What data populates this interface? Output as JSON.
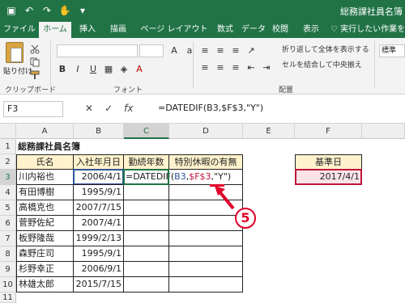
{
  "window": {
    "doc_title": "総務課社員名簿"
  },
  "ribbon": {
    "tabs": [
      "ファイル",
      "ホーム",
      "挿入",
      "描画",
      "ページ レイアウト",
      "数式",
      "データ",
      "校閲",
      "表示"
    ],
    "active_tab": "ホーム",
    "tell_me": "実行したい作業を入",
    "paste_label": "貼り付け",
    "group_clipboard": "クリップボード",
    "group_font": "フォント",
    "group_alignment": "配置",
    "wrap_text": "折り返して全体を表示する",
    "merge_center": "セルを結合して中央揃え",
    "number_format": "標準"
  },
  "formula_bar": {
    "name_box": "F3",
    "formula": "=DATEDIF(B3,$F$3,\"Y\")"
  },
  "sheet": {
    "columns": [
      "A",
      "B",
      "C",
      "D",
      "E",
      "F"
    ],
    "rows": [
      "1",
      "2",
      "3",
      "4",
      "5",
      "6",
      "7",
      "8",
      "9",
      "10",
      "11"
    ],
    "title": "総務課社員名簿",
    "headers": {
      "name": "氏名",
      "join_date": "入社年月日",
      "years": "勤続年数",
      "special_leave": "特別休暇の有無"
    },
    "employees": [
      {
        "name": "川内裕也",
        "date": "2006/4/1"
      },
      {
        "name": "有田博樹",
        "date": "1995/9/1"
      },
      {
        "name": "高橋克也",
        "date": "2007/7/15"
      },
      {
        "name": "菅野佐紀",
        "date": "2007/4/1"
      },
      {
        "name": "板野隆哉",
        "date": "1999/2/13"
      },
      {
        "name": "森野庄司",
        "date": "1995/9/1"
      },
      {
        "name": "杉野幸正",
        "date": "2006/9/1"
      },
      {
        "name": "林雄太郎",
        "date": "2015/7/15"
      }
    ],
    "editing": {
      "prefix": "=DATEDIF(",
      "ref_b3": "B3",
      "comma1": ",",
      "ref_f3": "$F$3",
      "tail": ",\"Y\")"
    },
    "base_date_label": "基準日",
    "base_date_value": "2017/4/1"
  },
  "annotation": {
    "step_number": "5"
  },
  "colors": {
    "excel_green": "#217346",
    "header_yellow": "#fff2cc",
    "base_pink": "#fbe4e8",
    "ref_blue": "#2f5597",
    "ref_red": "#c0143c",
    "callout_red": "#e0002a"
  }
}
